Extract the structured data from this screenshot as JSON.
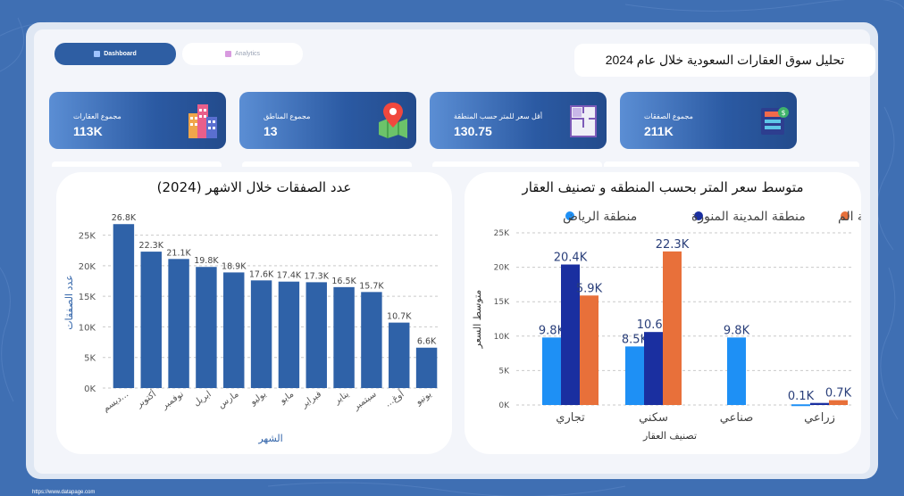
{
  "header": {
    "title": "تحليل سوق العقارات السعودية خلال عام 2024",
    "nav": [
      {
        "label": "Dashboard",
        "icon": "dashboard-icon"
      },
      {
        "label": "Analytics",
        "icon": "analytics-icon"
      }
    ]
  },
  "kpis": [
    {
      "label": "مجموع العقارات",
      "value": "113K",
      "icon": "buildings-icon"
    },
    {
      "label": "مجموع المناطق",
      "value": "13",
      "icon": "map-pin-icon"
    },
    {
      "label": "أقل سعر للمتر حسب المنطقة",
      "value": "130.75",
      "icon": "floorplan-icon"
    },
    {
      "label": "مجموع الصفقات",
      "value": "211K",
      "icon": "money-deal-icon"
    }
  ],
  "footer": {
    "url": "https://www.datapage.com"
  },
  "chart_data": [
    {
      "type": "bar",
      "title": "عدد الصفقات خلال الاشهر (2024)",
      "xlabel": "الشهر",
      "ylabel": "عدد الصفقات",
      "ylim": [
        0,
        28000
      ],
      "yticks": [
        0,
        5000,
        10000,
        15000,
        20000,
        25000
      ],
      "ytick_labels": [
        "0K",
        "5K",
        "10K",
        "15K",
        "20K",
        "25K"
      ],
      "categories": [
        "ديسم...",
        "أكتوبر",
        "نوفمبر",
        "ابريل",
        "مارس",
        "يوليو",
        "مايو",
        "فبراير",
        "يناير",
        "سبتمبر",
        "...أوغ",
        "يونيو"
      ],
      "values": [
        26800,
        22300,
        21100,
        19800,
        18900,
        17600,
        17400,
        17300,
        16500,
        15700,
        10700,
        6600
      ],
      "data_labels": [
        "26.8K",
        "22.3K",
        "21.1K",
        "19.8K",
        "18.9K",
        "17.6K",
        "17.4K",
        "17.3K",
        "16.5K",
        "15.7K",
        "10.7K",
        "6.6K"
      ],
      "color": "#2f62a8",
      "grid": true
    },
    {
      "type": "bar",
      "title": "متوسط سعر المتر بحسب المنطقه و تصنيف العقار",
      "xlabel": "تصنيف العقار",
      "ylabel": "متوسط السعر",
      "ylim": [
        0,
        25000
      ],
      "yticks": [
        0,
        5000,
        10000,
        15000,
        20000,
        25000
      ],
      "ytick_labels": [
        "0K",
        "5K",
        "10K",
        "15K",
        "20K",
        "25K"
      ],
      "categories": [
        "تجاري",
        "سكني",
        "صناعي",
        "زراعي"
      ],
      "legend_position": "top",
      "grid": true,
      "series": [
        {
          "name": "منطقة الرياض",
          "color": "#1e90f5",
          "values": [
            9800,
            8500,
            9800,
            100
          ],
          "labels": [
            "9.8K",
            "8.5K",
            "9.8K",
            "0.1K"
          ]
        },
        {
          "name": "منطقة المدينة المنورة",
          "color": "#1a2fa0",
          "values": [
            20400,
            10600,
            null,
            300
          ],
          "labels": [
            "20.4K",
            "10.6K",
            "",
            ""
          ]
        },
        {
          "name": "...منطقة مكة الم",
          "color": "#e8703a",
          "values": [
            15900,
            22300,
            null,
            700
          ],
          "labels": [
            "5.9K",
            "22.3K",
            "",
            "0.7K"
          ]
        }
      ]
    }
  ]
}
